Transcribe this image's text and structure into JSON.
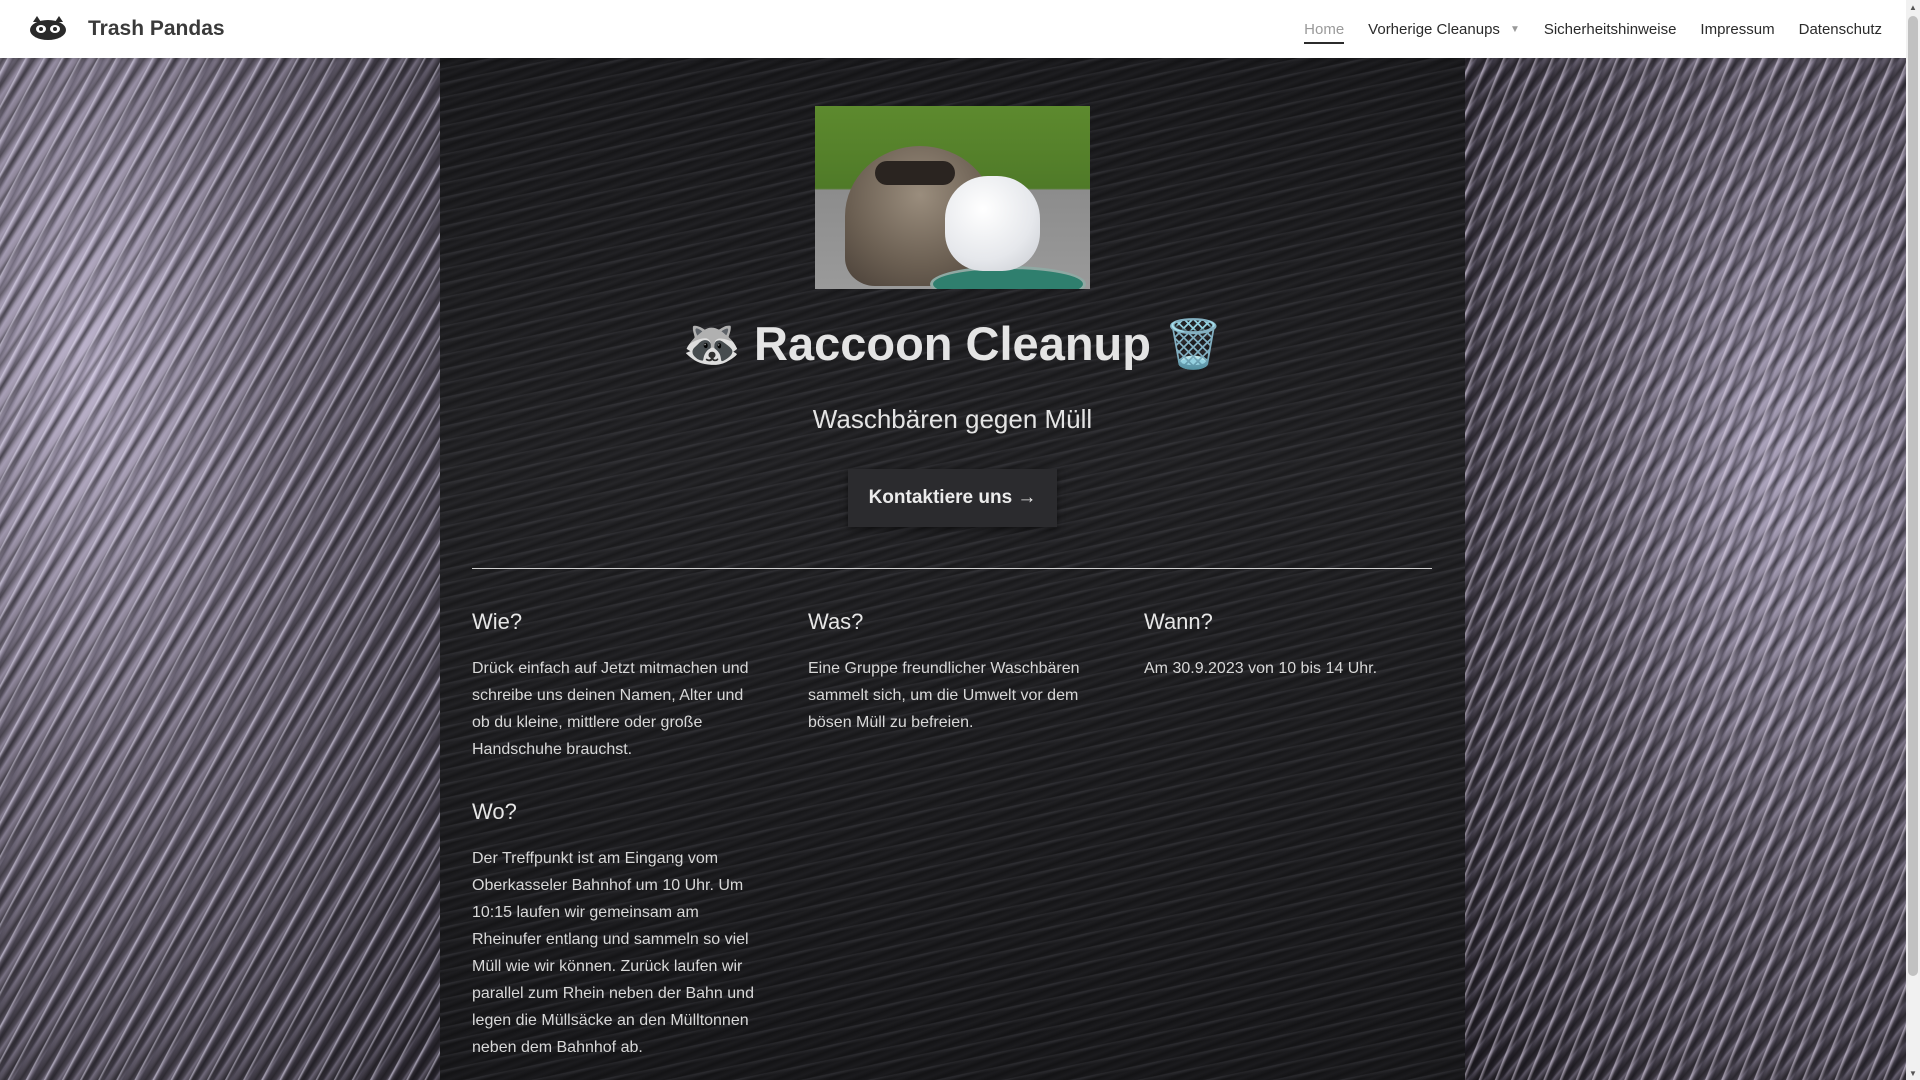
{
  "header": {
    "site_title": "Trash Pandas",
    "logo_icon": "raccoon-logo-icon",
    "nav": [
      {
        "label": "Home",
        "active": true
      },
      {
        "label": "Vorherige Cleanups",
        "has_dropdown": true
      },
      {
        "label": "Sicherheitshinweise"
      },
      {
        "label": "Impressum"
      },
      {
        "label": "Datenschutz"
      }
    ]
  },
  "hero": {
    "title": "🦝 Raccoon Cleanup 🗑️",
    "subtitle": "Waschbären gegen Müll",
    "cta_label": "Kontaktiere uns →"
  },
  "sections": {
    "wie": {
      "heading": "Wie?",
      "text": "Drück einfach auf Jetzt mitmachen und schreibe uns deinen Namen, Alter und ob du kleine, mittlere oder große Handschuhe brauchst."
    },
    "was": {
      "heading": "Was?",
      "text": "Eine Gruppe freundlicher Waschbären sammelt sich, um die Umwelt vor dem bösen Müll zu befreien."
    },
    "wann": {
      "heading": "Wann?",
      "text": "Am 30.9.2023 von 10 bis 14 Uhr."
    },
    "wo": {
      "heading": "Wo?",
      "text": "Der Treffpunkt ist am Eingang vom Oberkasseler Bahnhof um 10 Uhr. Um 10:15 laufen wir gemeinsam am Rheinufer entlang und sammeln so viel Müll wie wir können. Zurück laufen wir parallel zum Rhein neben der Bahn und legen die Müllsäcke an den Mülltonnen neben dem Bahnhof ab."
    }
  },
  "colors": {
    "panel_bg": "#1d1d20",
    "header_bg": "#ffffff",
    "text_light": "#e4e4e4",
    "nav_active": "#9a9a9a"
  }
}
